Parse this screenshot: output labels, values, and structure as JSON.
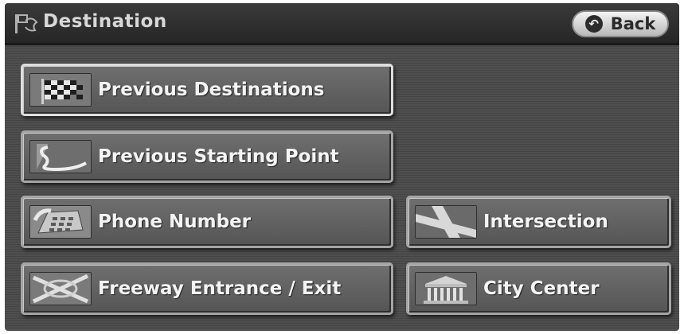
{
  "header": {
    "title": "Destination",
    "back_label": "Back",
    "title_icon": "destination-flag-icon",
    "back_icon": "back-arrow-icon"
  },
  "menu": {
    "previous_destinations": {
      "label": "Previous Destinations",
      "icon": "checkered-flag-icon"
    },
    "previous_starting_point": {
      "label": "Previous Starting Point",
      "icon": "route-s-icon"
    },
    "phone_number": {
      "label": "Phone Number",
      "icon": "phone-icon"
    },
    "intersection": {
      "label": "Intersection",
      "icon": "intersection-icon"
    },
    "freeway_entrance_exit": {
      "label": "Freeway Entrance / Exit",
      "icon": "freeway-interchange-icon"
    },
    "city_center": {
      "label": "City Center",
      "icon": "city-hall-icon"
    }
  },
  "colors": {
    "background": "#4f4f4f",
    "header": "#2c2c2c",
    "button_face": "#606060",
    "button_text": "#f4f4f4",
    "selected_border": "#dedede"
  }
}
